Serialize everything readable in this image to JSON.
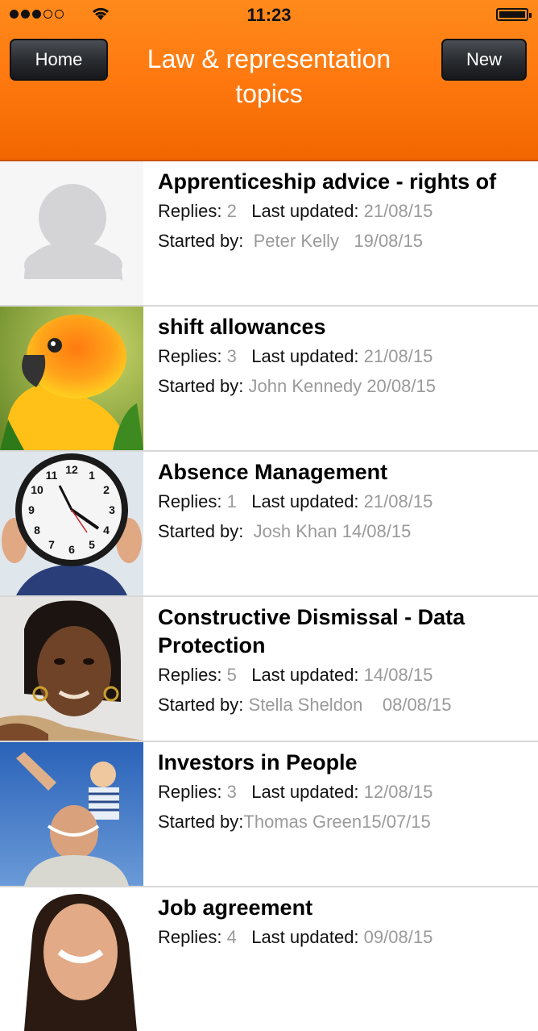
{
  "status": {
    "time": "11:23"
  },
  "header": {
    "home_label": "Home",
    "new_label": "New",
    "title": "Law & representation topics"
  },
  "labels": {
    "replies": "Replies:",
    "last_updated": "Last updated:",
    "started_by": "Started by:"
  },
  "topics": [
    {
      "title": "Apprenticeship advice - rights of",
      "replies": "2",
      "updated": "21/08/15",
      "author": "Peter Kelly",
      "started": "19/08/15",
      "avatar": "default-avatar-icon"
    },
    {
      "title": "shift allowances",
      "replies": "3",
      "updated": "21/08/15",
      "author": "John Kennedy",
      "started": "20/08/15",
      "avatar": "parrot-photo"
    },
    {
      "title": "Absence Management",
      "replies": "1",
      "updated": "21/08/15",
      "author": "Josh Khan",
      "started": "14/08/15",
      "avatar": "clock-photo"
    },
    {
      "title": "Constructive Dismissal - Data Protection",
      "replies": "5",
      "updated": "14/08/15",
      "author": "Stella Sheldon",
      "started": "08/08/15",
      "avatar": "woman-photo"
    },
    {
      "title": "Investors in People",
      "replies": "3",
      "updated": "12/08/15",
      "author": "Thomas Green",
      "started": "15/07/15",
      "avatar": "father-child-photo"
    },
    {
      "title": "Job agreement",
      "replies": "4",
      "updated": "09/08/15",
      "author": "",
      "started": "",
      "avatar": "smiling-woman-photo"
    }
  ]
}
